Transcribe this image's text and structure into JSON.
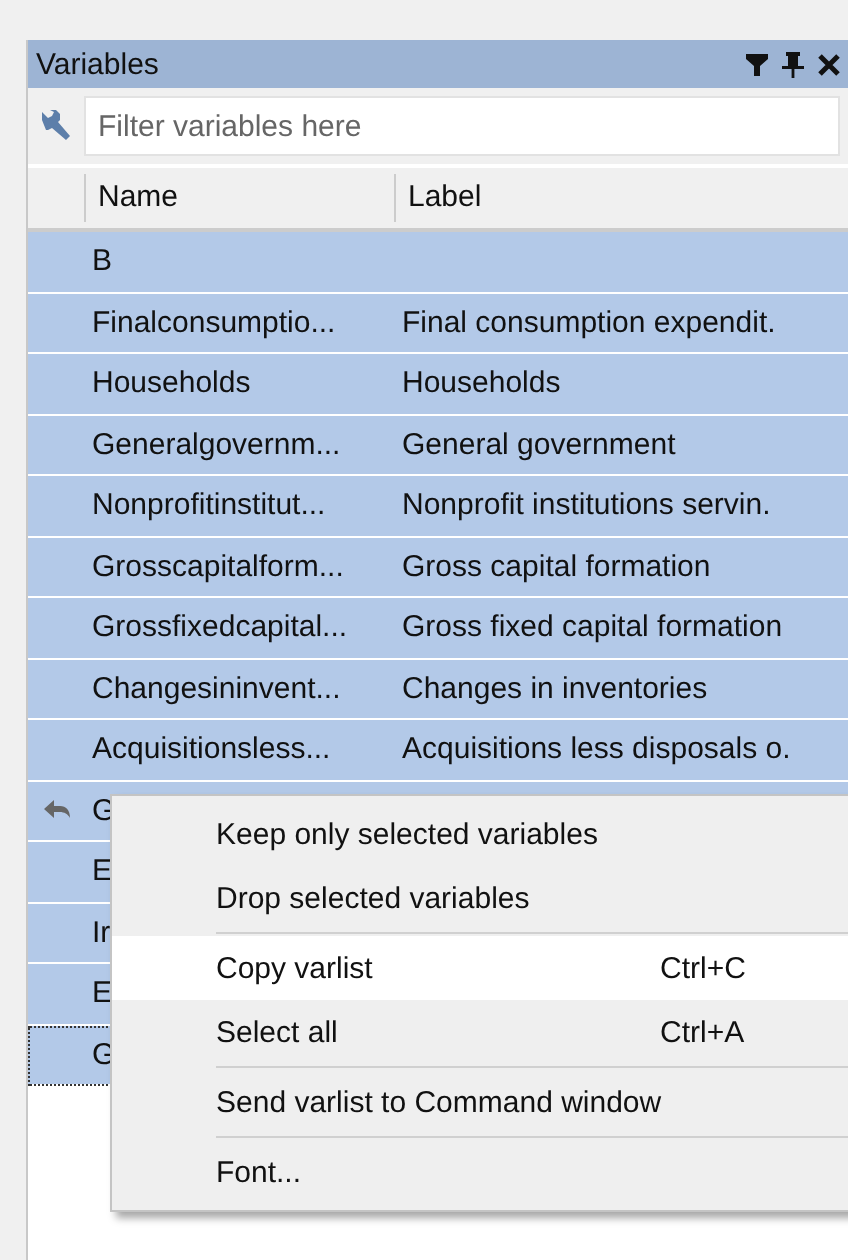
{
  "panel": {
    "title": "Variables",
    "filter": {
      "placeholder": "Filter variables here"
    }
  },
  "table": {
    "columns": [
      "Name",
      "Label"
    ],
    "rows": [
      {
        "name": "B",
        "selected": true,
        "focused": false,
        "current": false
      },
      {
        "name": "Finalconsumptio...",
        "label": "Final consumption expendit.",
        "selected": true,
        "focused": false,
        "current": false
      },
      {
        "name": "Households",
        "label": "Households",
        "selected": true,
        "focused": false,
        "current": false
      },
      {
        "name": "Generalgovernm...",
        "label": "General government",
        "selected": true,
        "focused": false,
        "current": false
      },
      {
        "name": "Nonprofitinstitut...",
        "label": "Nonprofit institutions servin.",
        "selected": true,
        "focused": false,
        "current": false
      },
      {
        "name": "Grosscapitalform...",
        "label": "Gross capital formation",
        "selected": true,
        "focused": false,
        "current": false
      },
      {
        "name": "Grossfixedcapital...",
        "label": "Gross fixed capital formation",
        "selected": true,
        "focused": false,
        "current": false
      },
      {
        "name": "Changesininvent...",
        "label": "Changes in inventories",
        "selected": true,
        "focused": false,
        "current": false
      },
      {
        "name": "Acquisitionsless...",
        "label": "Acquisitions less disposals o.",
        "selected": true,
        "focused": false,
        "current": false
      },
      {
        "name": "G",
        "selected": true,
        "focused": false,
        "current": true
      },
      {
        "name": "E",
        "selected": true,
        "focused": false,
        "current": false
      },
      {
        "name": "Ir",
        "selected": true,
        "focused": false,
        "current": false
      },
      {
        "name": "E",
        "selected": true,
        "focused": false,
        "current": false
      },
      {
        "name": "G",
        "selected": true,
        "focused": true,
        "current": false
      }
    ]
  },
  "context_menu": {
    "groups": [
      [
        {
          "label": "Keep only selected variables",
          "selected": false
        },
        {
          "label": "Drop selected variables",
          "selected": false
        }
      ],
      [
        {
          "label": "Copy varlist",
          "shortcut": "Ctrl+C",
          "selected": true
        },
        {
          "label": "Select all",
          "shortcut": "Ctrl+A",
          "selected": false
        }
      ],
      [
        {
          "label": "Send varlist to Command window",
          "selected": false
        }
      ],
      [
        {
          "label": "Font...",
          "selected": false
        }
      ]
    ]
  }
}
